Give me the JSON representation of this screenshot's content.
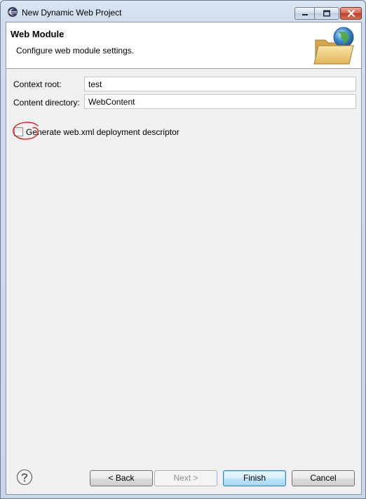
{
  "window": {
    "title": "New Dynamic Web Project",
    "icons": {
      "app": "eclipse-icon",
      "minimize": "minimize-icon",
      "maximize": "maximize-icon",
      "close": "close-icon"
    }
  },
  "banner": {
    "title": "Web Module",
    "description": "Configure web module settings.",
    "icon": "web-folder-globe-icon"
  },
  "form": {
    "context_root": {
      "label": "Context root:",
      "value": "test"
    },
    "content_directory": {
      "label": "Content directory:",
      "value": "WebContent"
    },
    "generate_descriptor": {
      "label": "Generate web.xml deployment descriptor",
      "checked": false
    }
  },
  "annotation": {
    "shape": "red-hand-drawn-circle",
    "color": "#e01010"
  },
  "footer": {
    "help_icon": "help-icon",
    "back": "< Back",
    "next": "Next >",
    "finish": "Finish",
    "cancel": "Cancel"
  }
}
